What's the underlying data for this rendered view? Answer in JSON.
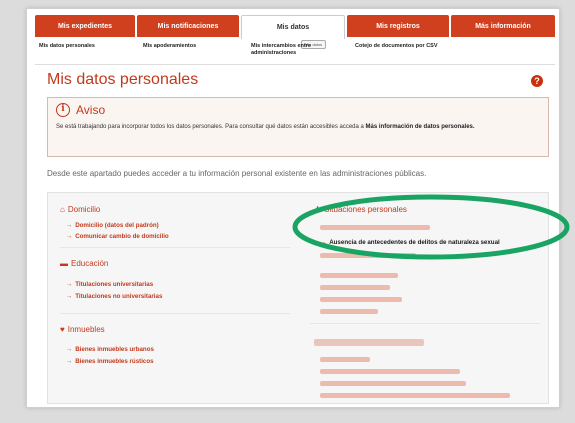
{
  "tabs": [
    {
      "label": "Mis expedientes",
      "active": false
    },
    {
      "label": "Mis notificaciones",
      "active": false
    },
    {
      "label": "Mis datos",
      "active": true
    },
    {
      "label": "Mis registros",
      "active": false
    },
    {
      "label": "Más información",
      "active": false
    }
  ],
  "tab_tooltip": "Mis datos",
  "subnav": {
    "items": [
      "Mis datos personales",
      "Mis apoderamientos",
      "Mis intercambios entre administraciones",
      "Cotejo de documentos por CSV"
    ]
  },
  "page_title": "Mis datos personales",
  "help_icon": "?",
  "notice": {
    "title": "Aviso",
    "text_prefix": "Se está trabajando para incorporar todos los datos personales. Para consultar qué datos están accesibles acceda a",
    "text_link": "Más información de datos personales."
  },
  "intro": "Desde este apartado puedes acceder a tu información personal existente en las administraciones públicas.",
  "sections_left": {
    "domicilio": {
      "title": "Domicilio",
      "icon": "home-icon",
      "links": [
        "Domicilio (datos del padrón)",
        "Comunicar cambio de domicilio"
      ]
    },
    "educacion": {
      "title": "Educación",
      "icon": "graduation-icon",
      "links": [
        "Titulaciones universitarias",
        "Titulaciones no universitarias"
      ]
    },
    "inmuebles": {
      "title": "Inmuebles",
      "icon": "building-icon",
      "links": [
        "Bienes inmuebles urbanos",
        "Bienes inmuebles rústicos"
      ]
    }
  },
  "sections_right": {
    "situaciones": {
      "title": "Situaciones personales",
      "icon": "person-icon",
      "highlighted_link": "Ausencia de antecedentes de delitos de naturaleza sexual"
    }
  },
  "colors": {
    "accent": "#c23a1c",
    "tab": "#d0401f",
    "highlight": "#19a463"
  }
}
